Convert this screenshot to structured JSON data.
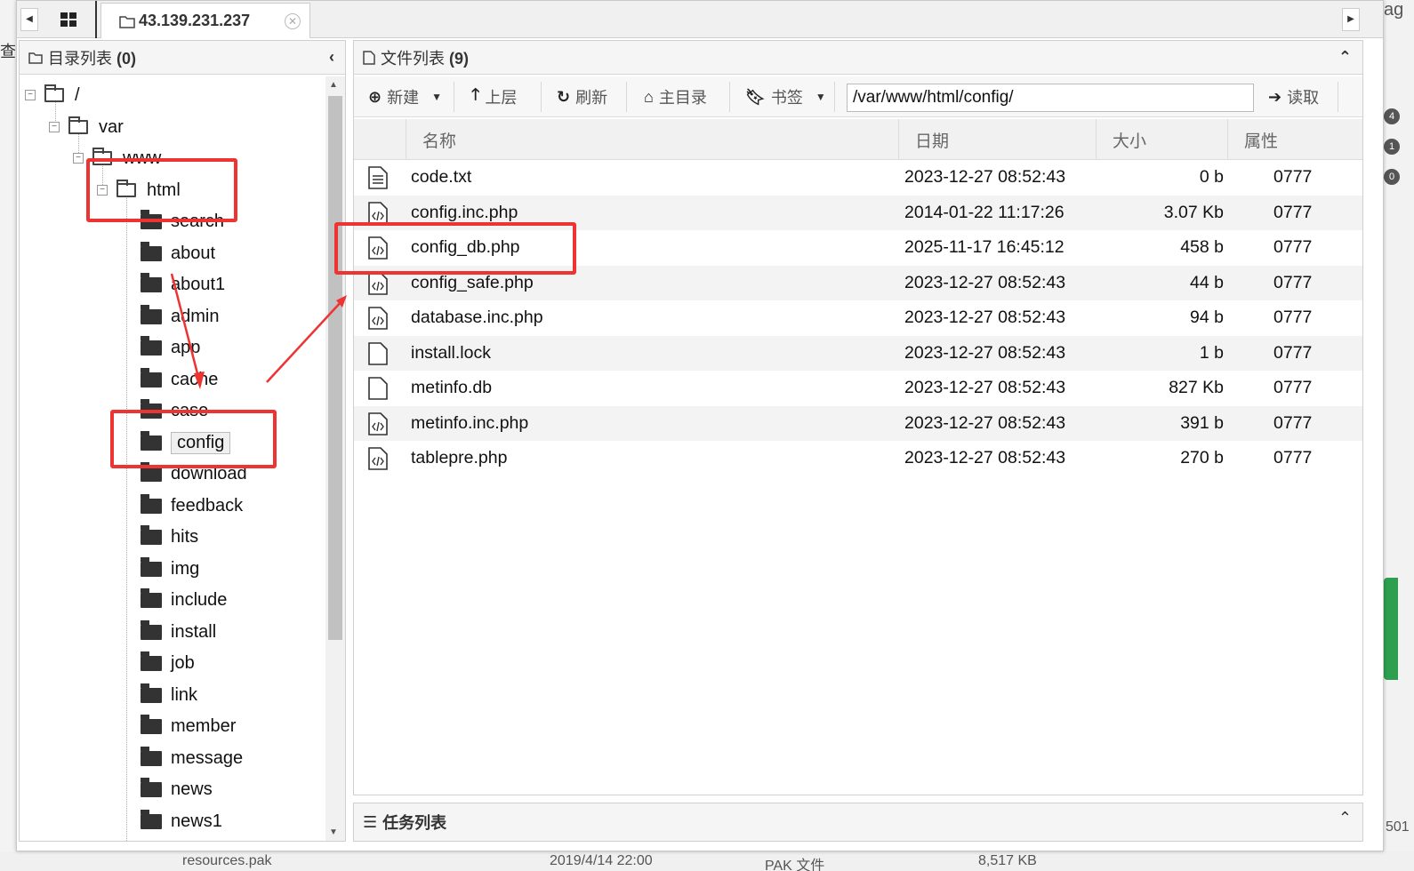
{
  "tabs": {
    "active_label": "43.139.231.237"
  },
  "left_panel": {
    "title": "目录列表",
    "count": "(0)"
  },
  "tree": {
    "root": "/",
    "var": "var",
    "www": "www",
    "html": "html",
    "folders": [
      "search",
      "about",
      "about1",
      "admin",
      "app",
      "cache",
      "case",
      "config",
      "download",
      "feedback",
      "hits",
      "img",
      "include",
      "install",
      "job",
      "link",
      "member",
      "message",
      "news",
      "news1"
    ],
    "selected": "config"
  },
  "right_panel": {
    "title": "文件列表",
    "count": "(9)"
  },
  "toolbar": {
    "new_label": "新建",
    "up_label": "上层",
    "refresh_label": "刷新",
    "home_label": "主目录",
    "bookmark_label": "书签",
    "path_value": "/var/www/html/config/",
    "read_label": "读取"
  },
  "table": {
    "columns": [
      "名称",
      "日期",
      "大小",
      "属性"
    ],
    "rows": [
      {
        "name": "code.txt",
        "date": "2023-12-27 08:52:43",
        "size": "0 b",
        "perm": "0777",
        "icon": "text-file-icon"
      },
      {
        "name": "config.inc.php",
        "date": "2014-01-22 11:17:26",
        "size": "3.07 Kb",
        "perm": "0777",
        "icon": "code-file-icon"
      },
      {
        "name": "config_db.php",
        "date": "2025-11-17 16:45:12",
        "size": "458 b",
        "perm": "0777",
        "icon": "code-file-icon"
      },
      {
        "name": "config_safe.php",
        "date": "2023-12-27 08:52:43",
        "size": "44 b",
        "perm": "0777",
        "icon": "code-file-icon"
      },
      {
        "name": "database.inc.php",
        "date": "2023-12-27 08:52:43",
        "size": "94 b",
        "perm": "0777",
        "icon": "code-file-icon"
      },
      {
        "name": "install.lock",
        "date": "2023-12-27 08:52:43",
        "size": "1 b",
        "perm": "0777",
        "icon": "blank-file-icon"
      },
      {
        "name": "metinfo.db",
        "date": "2023-12-27 08:52:43",
        "size": "827 Kb",
        "perm": "0777",
        "icon": "blank-file-icon"
      },
      {
        "name": "metinfo.inc.php",
        "date": "2023-12-27 08:52:43",
        "size": "391 b",
        "perm": "0777",
        "icon": "code-file-icon"
      },
      {
        "name": "tablepre.php",
        "date": "2023-12-27 08:52:43",
        "size": "270 b",
        "perm": "0777",
        "icon": "code-file-icon"
      }
    ]
  },
  "task_panel": {
    "title": "任务列表"
  },
  "background": {
    "right_top_text": "ag",
    "left_text": "查看",
    "badges": [
      "4",
      "1",
      "0"
    ],
    "bottom_name": "resources.pak",
    "bottom_date": "2019/4/14 22:00",
    "bottom_type": "PAK 文件",
    "bottom_size": "8,517 KB",
    "right_bottom_text": "501"
  },
  "colors": {
    "annotation_red": "#ee3333",
    "alt_row": "#f3f3f3"
  }
}
